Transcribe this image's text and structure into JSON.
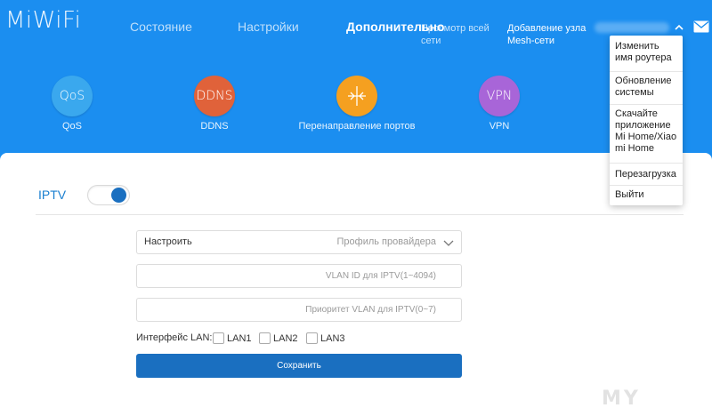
{
  "header": {
    "logo": "MiWiFi",
    "nav": {
      "status": "Состояние",
      "settings": "Настройки",
      "advanced": "Дополнительно",
      "mesh_view": "Просмотр всей сети",
      "mesh_add": "Добавление узла Mesh-сети"
    },
    "icons": {
      "caret": "chevron-up-icon",
      "mail": "mail-icon"
    }
  },
  "features": [
    {
      "circle_text": "QoS",
      "label": "QoS",
      "color": "#3aa8ee"
    },
    {
      "circle_text": "DDNS",
      "label": "DDNS",
      "color": "#e0623a"
    },
    {
      "circle_text": "",
      "label": "Перенаправление портов",
      "color": "#f5a020",
      "icon": "port-forward-icon"
    },
    {
      "circle_text": "VPN",
      "label": "VPN",
      "color": "#a865d8"
    }
  ],
  "iptv": {
    "label": "IPTV",
    "enabled": true,
    "select": {
      "value": "Настроить",
      "hint": "Профиль провайдера"
    },
    "vlan_id_placeholder": "VLAN ID для IPTV(1~4094)",
    "vlan_priority_placeholder": "Приоритет VLAN для IPTV(0~7)",
    "lan_label": "Интерфейс LAN:",
    "lan_options": [
      "LAN1",
      "LAN2",
      "LAN3"
    ],
    "save_label": "Сохранить"
  },
  "user_menu": {
    "items": [
      "Изменить имя роутера",
      "Обновление системы",
      "Скачайте приложение Mi Home/Xiao mi Home",
      "Перезагрузка",
      "Выйти"
    ]
  },
  "watermark": "MY"
}
